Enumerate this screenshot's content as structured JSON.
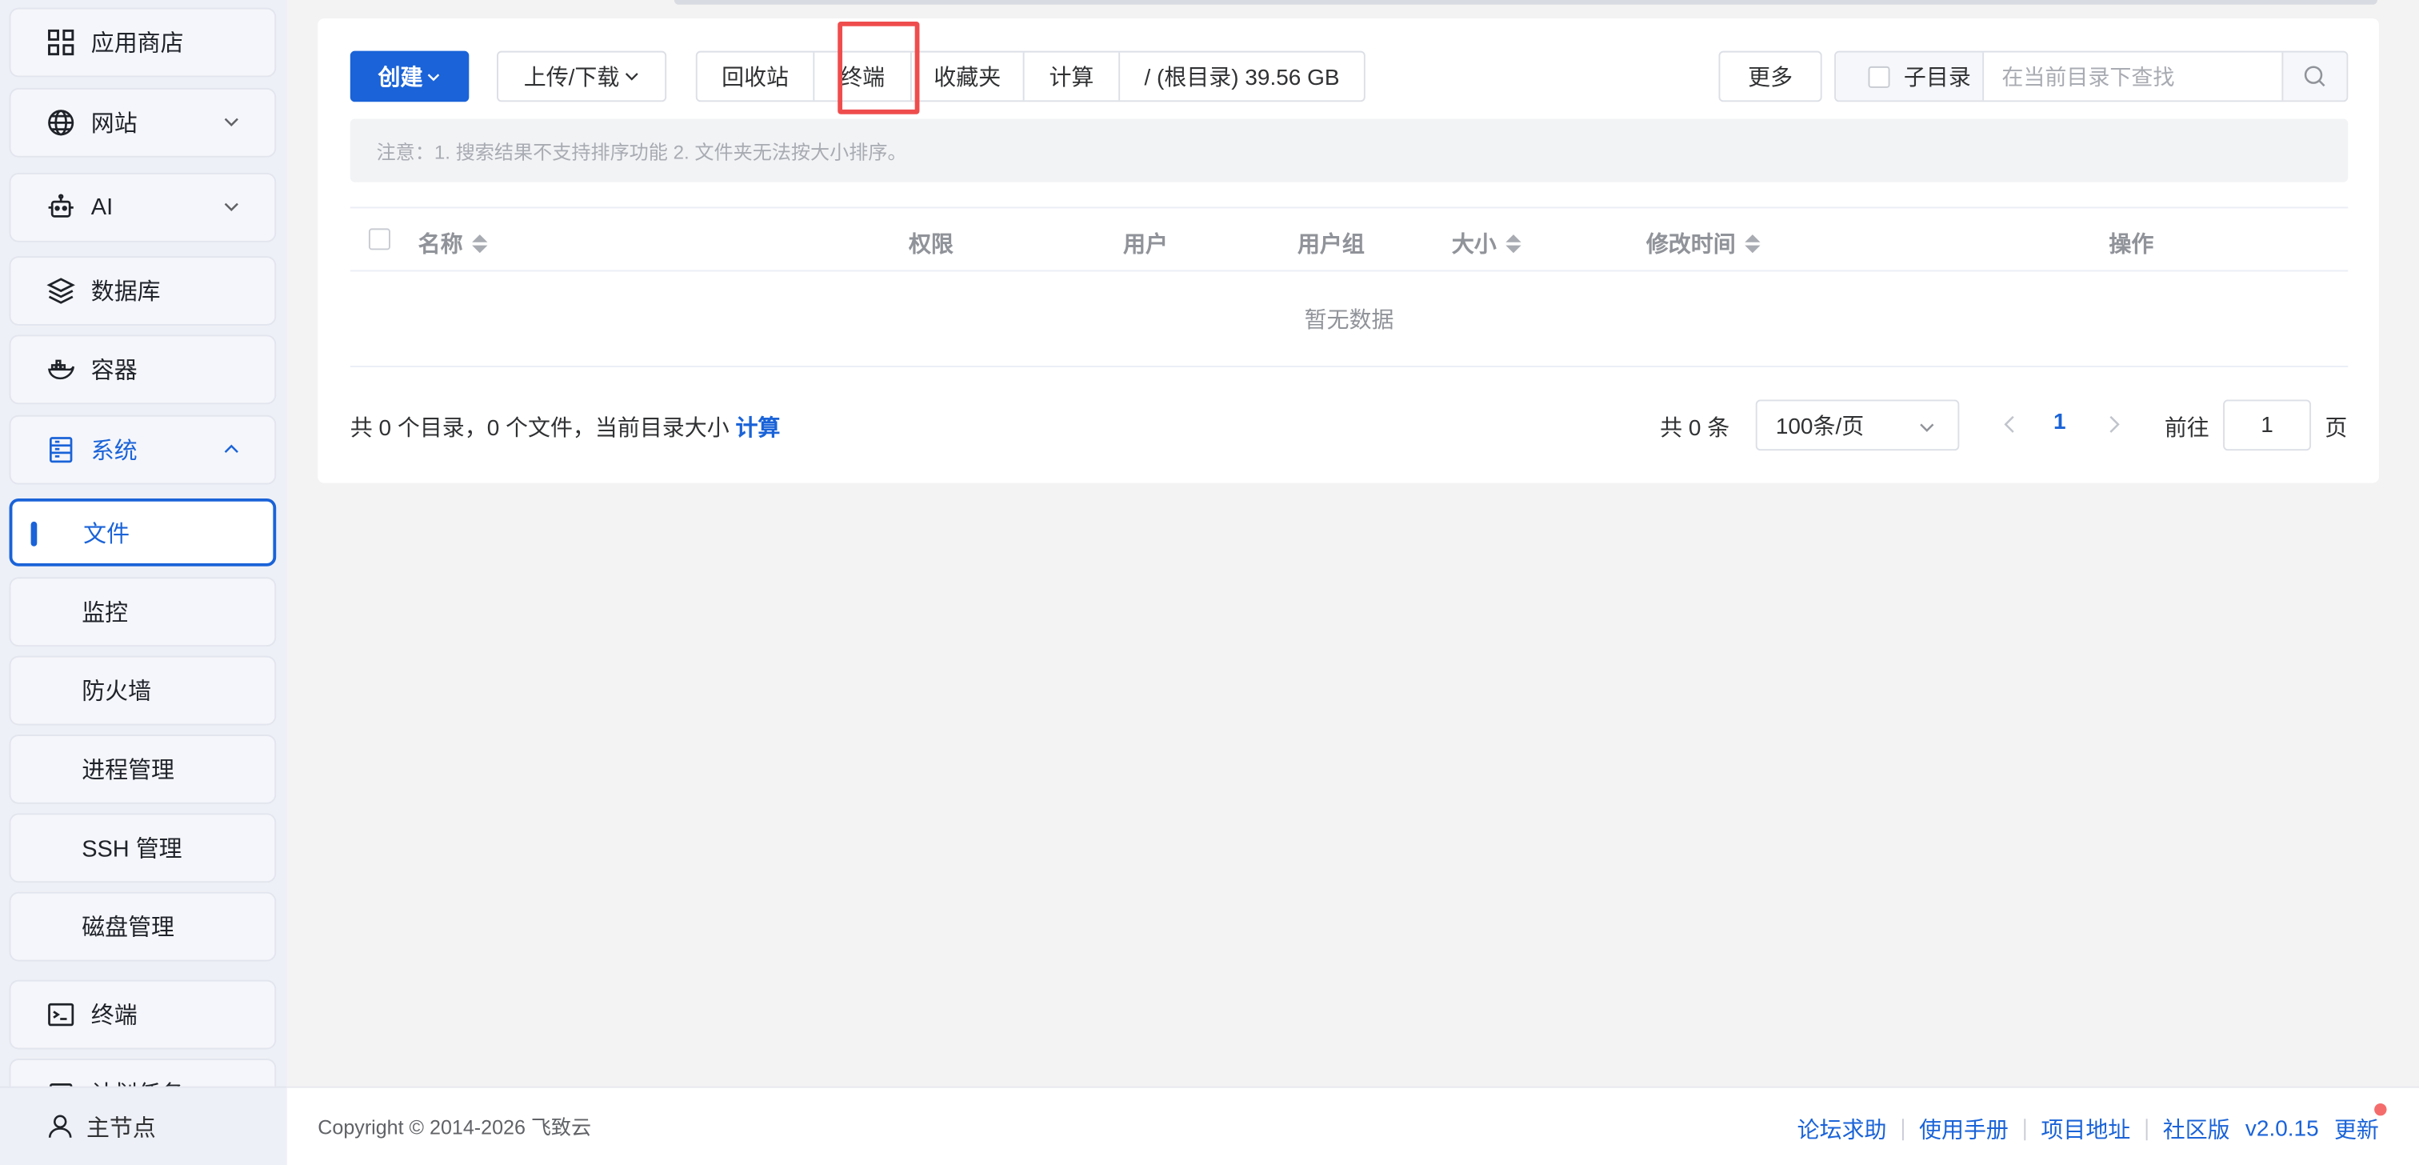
{
  "sidebar": {
    "items": [
      {
        "label": "应用商店",
        "icon": "grid-icon"
      },
      {
        "label": "网站",
        "icon": "globe-icon"
      },
      {
        "label": "AI",
        "icon": "robot-icon"
      },
      {
        "label": "数据库",
        "icon": "layers-icon"
      },
      {
        "label": "容器",
        "icon": "docker-icon"
      },
      {
        "label": "系统",
        "icon": "server-icon"
      }
    ],
    "system_sub": [
      "文件",
      "监控",
      "防火墙",
      "进程管理",
      "SSH 管理",
      "磁盘管理"
    ],
    "terminal": {
      "label": "终端",
      "icon": "terminal-icon"
    },
    "cut_item": "计划任务",
    "node": {
      "label": "主节点",
      "icon": "user-icon"
    }
  },
  "toolbar": {
    "create": "创建",
    "upload": "上传/下载",
    "recycle": "回收站",
    "terminal": "终端",
    "favorites": "收藏夹",
    "calc": "计算",
    "path": "/ (根目录) 39.56 GB",
    "more": "更多",
    "subdir": "子目录",
    "search_placeholder": "在当前目录下查找"
  },
  "notice": "注意：1. 搜索结果不支持排序功能 2. 文件夹无法按大小排序。",
  "table": {
    "headers": {
      "name": "名称",
      "perm": "权限",
      "user": "用户",
      "group": "用户组",
      "size": "大小",
      "mtime": "修改时间",
      "ops": "操作"
    },
    "empty": "暂无数据"
  },
  "summary": {
    "text": "共 0 个目录，0 个文件，当前目录大小",
    "link": "计算"
  },
  "pager": {
    "total": "共 0 条",
    "page_size": "100条/页",
    "current": "1",
    "goto_label": "前往",
    "goto_value": "1",
    "page_unit": "页"
  },
  "footer": {
    "copyright": "Copyright © 2014-2026 飞致云",
    "links": [
      "论坛求助",
      "使用手册",
      "项目地址",
      "社区版"
    ],
    "version": "v2.0.15",
    "update": "更新"
  },
  "colors": {
    "accent": "#1a63d8",
    "highlight": "#ef4d4d",
    "badge": "#f56c6c"
  }
}
